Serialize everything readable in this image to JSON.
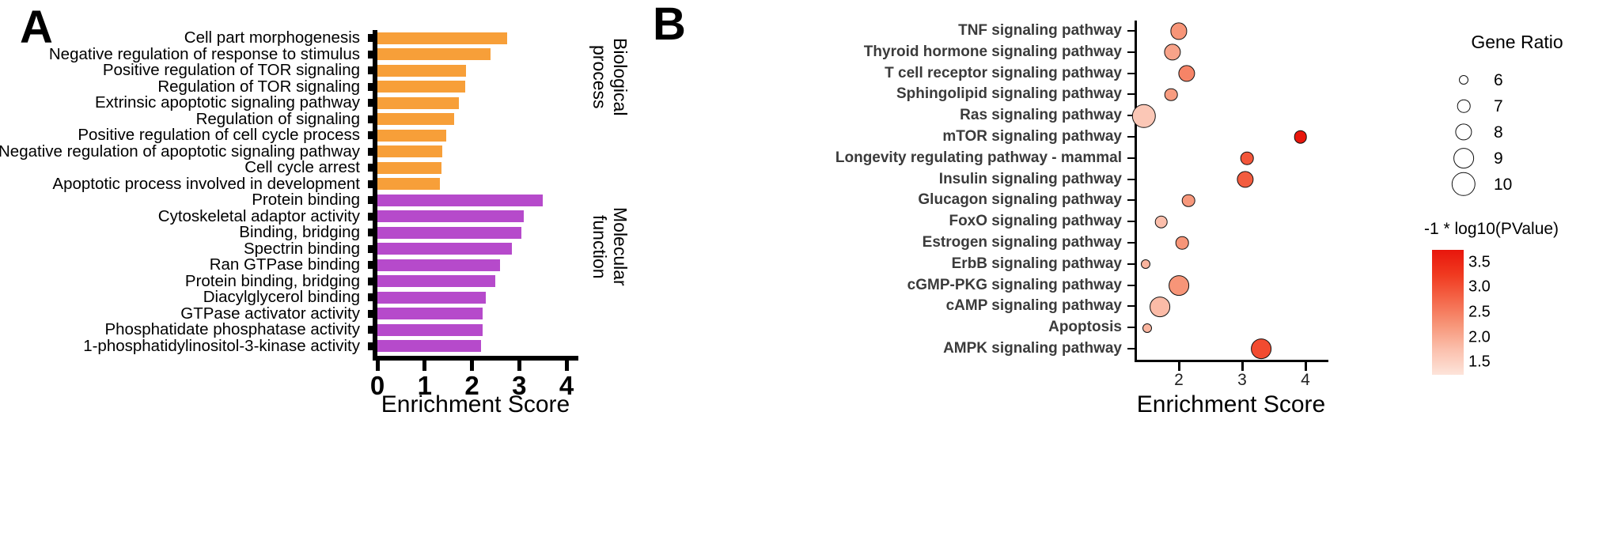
{
  "figure": {
    "panelA_letter": "A",
    "panelB_letter": "B"
  },
  "panelA": {
    "axis_title": "Enrichment Score",
    "xticks": [
      "0",
      "1",
      "2",
      "3",
      "4"
    ],
    "group_bp": "Biological\nprocess",
    "group_bp_line1": "Biological",
    "group_bp_line2": "process",
    "group_mf_line1": "Molecular",
    "group_mf_line2": "function",
    "color_bp": "#F79F39",
    "color_mf": "#B64ACB"
  },
  "panelB": {
    "axis_title": "Enrichment Score",
    "xticks": [
      "2",
      "3",
      "4"
    ],
    "size_legend": {
      "title": "Gene Ratio",
      "items": [
        "6",
        "7",
        "8",
        "9",
        "10"
      ]
    },
    "color_legend": {
      "title": "-1 * log10(PValue)",
      "ticks": [
        "3.5",
        "3.0",
        "2.5",
        "2.0",
        "1.5"
      ],
      "low_color": "#FDE4DA",
      "high_color": "#E8160C"
    }
  },
  "chart_data": [
    {
      "type": "bar",
      "title": "A",
      "orientation": "horizontal",
      "xlabel": "Enrichment Score",
      "ylabel": "",
      "xlim": [
        0,
        4.35
      ],
      "xticks": [
        0,
        1,
        2,
        3,
        4
      ],
      "grid": false,
      "series": [
        {
          "name": "Biological process",
          "color": "#F79F39",
          "categories": [
            "Cell part morphogenesis",
            "Negative regulation of response to stimulus",
            "Positive regulation of TOR signaling",
            "Regulation of TOR signaling",
            "Extrinsic apoptotic signaling pathway",
            "Regulation of signaling",
            "Positive regulation of cell cycle process",
            "Negative regulation of apoptotic signaling pathway",
            "Cell cycle arrest",
            "Apoptotic process involved in development"
          ],
          "values": [
            2.75,
            2.4,
            1.88,
            1.85,
            1.72,
            1.62,
            1.45,
            1.38,
            1.36,
            1.33
          ]
        },
        {
          "name": "Molecular function",
          "color": "#B64ACB",
          "categories": [
            "Protein binding",
            "Cytoskeletal adaptor activity",
            "Binding, bridging",
            "Spectrin binding",
            "Ran GTPase binding",
            "Protein binding, bridging",
            "Diacylglycerol binding",
            "GTPase activator activity",
            "Phosphatidate phosphatase activity",
            "1-phosphatidylinositol-3-kinase activity"
          ],
          "values": [
            3.5,
            3.1,
            3.05,
            2.85,
            2.6,
            2.5,
            2.3,
            2.22,
            2.22,
            2.2
          ]
        }
      ]
    },
    {
      "type": "scatter",
      "title": "B",
      "xlabel": "Enrichment Score",
      "ylabel": "",
      "xlim": [
        1.3,
        4.3
      ],
      "xticks": [
        2,
        3,
        4
      ],
      "grid": false,
      "size_label": "Gene Ratio",
      "size_range": [
        6,
        10
      ],
      "color_label": "-1 * log10(PValue)",
      "color_range": [
        1.3,
        3.8
      ],
      "points": [
        {
          "label": "TNF signaling pathway",
          "x": 2.0,
          "gene_ratio": 8,
          "neglog10p": 2.55
        },
        {
          "label": "Thyroid hormone signaling pathway",
          "x": 1.9,
          "gene_ratio": 8,
          "neglog10p": 2.35
        },
        {
          "label": "T cell receptor signaling pathway",
          "x": 2.12,
          "gene_ratio": 8,
          "neglog10p": 2.75
        },
        {
          "label": "Sphingolipid signaling pathway",
          "x": 1.88,
          "gene_ratio": 7,
          "neglog10p": 2.45
        },
        {
          "label": "Ras signaling pathway",
          "x": 1.45,
          "gene_ratio": 10,
          "neglog10p": 1.8
        },
        {
          "label": "mTOR signaling pathway",
          "x": 3.92,
          "gene_ratio": 7,
          "neglog10p": 3.8
        },
        {
          "label": "Longevity regulating pathway - mammal",
          "x": 3.08,
          "gene_ratio": 7,
          "neglog10p": 3.25
        },
        {
          "label": "Insulin signaling pathway",
          "x": 3.05,
          "gene_ratio": 8,
          "neglog10p": 3.2
        },
        {
          "label": "Glucagon signaling pathway",
          "x": 2.15,
          "gene_ratio": 7,
          "neglog10p": 2.5
        },
        {
          "label": "FoxO signaling pathway",
          "x": 1.72,
          "gene_ratio": 7,
          "neglog10p": 1.95
        },
        {
          "label": "Estrogen signaling pathway",
          "x": 2.05,
          "gene_ratio": 7,
          "neglog10p": 2.55
        },
        {
          "label": "ErbB signaling pathway",
          "x": 1.48,
          "gene_ratio": 6,
          "neglog10p": 2.1
        },
        {
          "label": "cGMP-PKG signaling pathway",
          "x": 2.0,
          "gene_ratio": 9,
          "neglog10p": 2.55
        },
        {
          "label": "cAMP signaling pathway",
          "x": 1.7,
          "gene_ratio": 9,
          "neglog10p": 2.0
        },
        {
          "label": "Apoptosis",
          "x": 1.5,
          "gene_ratio": 6,
          "neglog10p": 2.1
        },
        {
          "label": "AMPK signaling pathway",
          "x": 3.3,
          "gene_ratio": 9,
          "neglog10p": 3.35
        }
      ]
    }
  ]
}
